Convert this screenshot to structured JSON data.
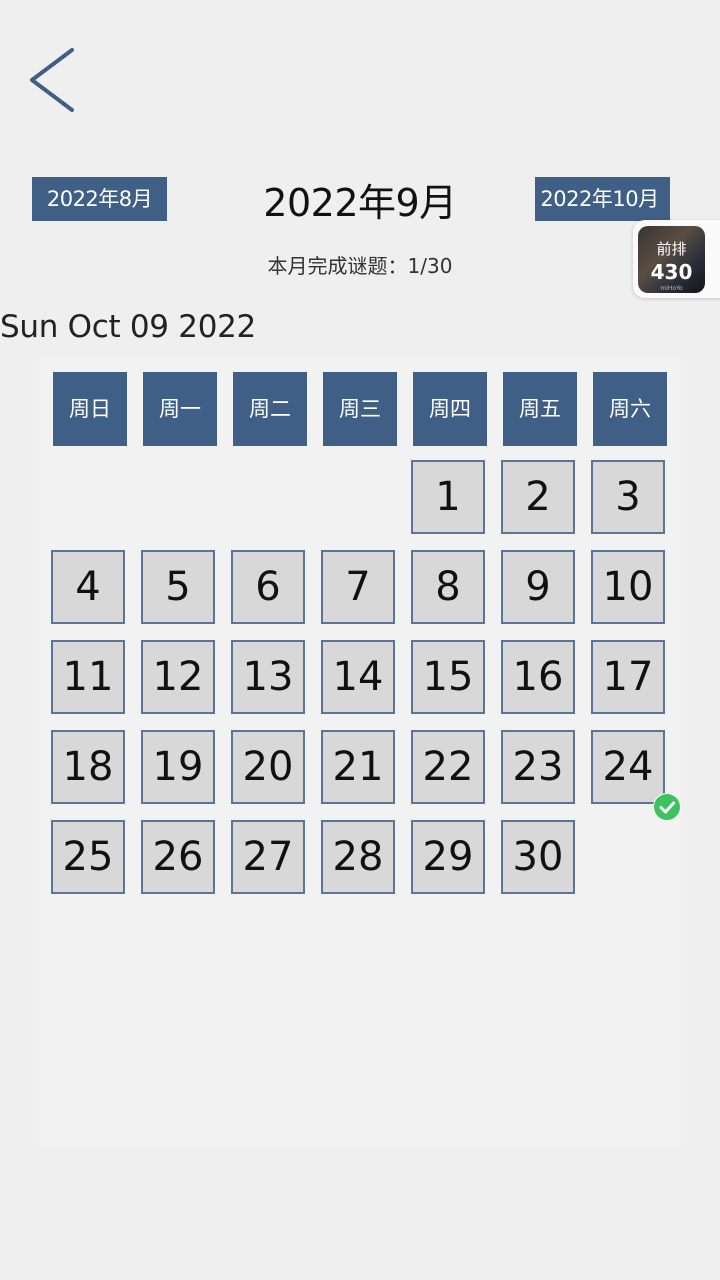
{
  "nav": {
    "prev_label": "2022年8月",
    "next_label": "2022年10月",
    "month_title": "2022年9月",
    "month_stats": "本月完成谜题：1/30"
  },
  "current_date_text": "Sun Oct 09 2022",
  "badge": {
    "top_label": "前排",
    "count": "430",
    "brand": "miHoYo"
  },
  "weekdays": [
    "周日",
    "周一",
    "周二",
    "周三",
    "周四",
    "周五",
    "周六"
  ],
  "days": [
    "1",
    "2",
    "3",
    "4",
    "5",
    "6",
    "7",
    "8",
    "9",
    "10",
    "11",
    "12",
    "13",
    "14",
    "15",
    "16",
    "17",
    "18",
    "19",
    "20",
    "21",
    "22",
    "23",
    "24",
    "25",
    "26",
    "27",
    "28",
    "29",
    "30"
  ],
  "first_weekday_index": 4,
  "completed_days": [
    "24"
  ],
  "colors": {
    "accent": "#3f5f86",
    "cell_border": "#5b7498",
    "cell_bg": "#d8d8d8",
    "check": "#3cc35c"
  }
}
